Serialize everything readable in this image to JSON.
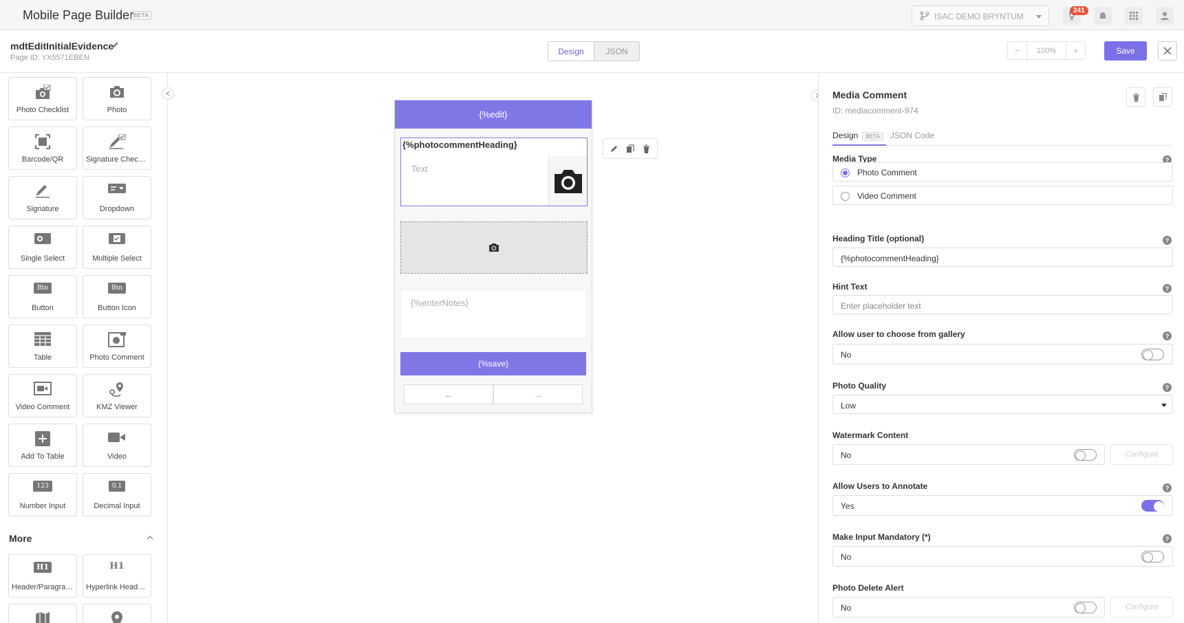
{
  "app": {
    "title": "Mobile Page Builder",
    "beta": "BETA"
  },
  "topbar": {
    "org": "ISAC DEMO BRYNTUM",
    "badge": "241"
  },
  "page": {
    "name": "mdtEditInitialEvidence",
    "id_label": "Page ID: YX5571EBEN"
  },
  "view_toggle": {
    "design": "Design",
    "json": "JSON"
  },
  "zoom": {
    "minus": "−",
    "value": "100%",
    "plus": "+"
  },
  "actions": {
    "save": "Save"
  },
  "palette": {
    "items": [
      {
        "label": "Photo Checklist",
        "icon": "photo-checklist-icon"
      },
      {
        "label": "Photo",
        "icon": "camera-icon"
      },
      {
        "label": "Barcode/QR",
        "icon": "barcode-icon"
      },
      {
        "label": "Signature Checklist",
        "icon": "signature-checklist-icon"
      },
      {
        "label": "Signature",
        "icon": "signature-icon"
      },
      {
        "label": "Dropdown",
        "icon": "dropdown-icon"
      },
      {
        "label": "Single Select",
        "icon": "single-select-icon"
      },
      {
        "label": "Multiple Select",
        "icon": "multiple-select-icon"
      },
      {
        "label": "Button",
        "icon": "button-icon",
        "glyph": "Btn"
      },
      {
        "label": "Button Icon",
        "icon": "button-icon-icon",
        "glyph": "Btn"
      },
      {
        "label": "Table",
        "icon": "table-icon"
      },
      {
        "label": "Photo Comment",
        "icon": "photo-comment-icon"
      },
      {
        "label": "Video Comment",
        "icon": "video-comment-icon"
      },
      {
        "label": "KMZ Viewer",
        "icon": "kmz-icon"
      },
      {
        "label": "Add To Table",
        "icon": "add-to-table-icon"
      },
      {
        "label": "Video",
        "icon": "video-icon"
      },
      {
        "label": "Number Input",
        "icon": "number-input-icon",
        "glyph": "123"
      },
      {
        "label": "Decimal Input",
        "icon": "decimal-input-icon",
        "glyph": "0.1"
      }
    ],
    "more_heading": "More",
    "more_items": [
      {
        "label": "Header/Paragraph",
        "icon": "header-icon",
        "glyph": "H1"
      },
      {
        "label": "Hyperlink Heade...",
        "icon": "hyperlink-header-icon",
        "glyph": "H1"
      },
      {
        "label": "",
        "icon": "map-icon"
      },
      {
        "label": "",
        "icon": "location-pin-icon"
      }
    ]
  },
  "phone": {
    "header": "{%edit}",
    "photo_comment_heading": "{%photocommentHeading}",
    "text_placeholder": "Text",
    "notes_placeholder": "{%enterNotes}",
    "save_label": "{%save}",
    "prev_glyph": "←",
    "next_glyph": "→"
  },
  "props": {
    "title": "Media Comment",
    "id": "ID: mediacomment-974",
    "tab_design": "Design",
    "tab_design_badge": "BETA",
    "tab_json": "JSON Code",
    "help_glyph": "?",
    "media_type": {
      "label": "Media Type",
      "options": [
        "Photo Comment",
        "Video Comment"
      ],
      "selected": "Photo Comment"
    },
    "heading_title": {
      "label": "Heading Title (optional)",
      "value": "{%photocommentHeading}"
    },
    "hint_text": {
      "label": "Hint Text",
      "placeholder": "Enter placeholder text"
    },
    "gallery": {
      "label": "Allow user to choose from gallery",
      "value": "No",
      "on": false
    },
    "photo_quality": {
      "label": "Photo Quality",
      "value": "Low"
    },
    "watermark": {
      "label": "Watermark Content",
      "value": "No",
      "on": false,
      "configure": "Configure"
    },
    "annotate": {
      "label": "Allow Users to Annotate",
      "value": "Yes",
      "on": true
    },
    "mandatory": {
      "label": "Make Input Mandatory (*)",
      "value": "No",
      "on": false
    },
    "delete_alert": {
      "label": "Photo Delete Alert",
      "value": "No",
      "on": false,
      "configure": "Configure"
    }
  },
  "colors": {
    "accent": "#7b70e8",
    "badge": "#e8533a"
  }
}
